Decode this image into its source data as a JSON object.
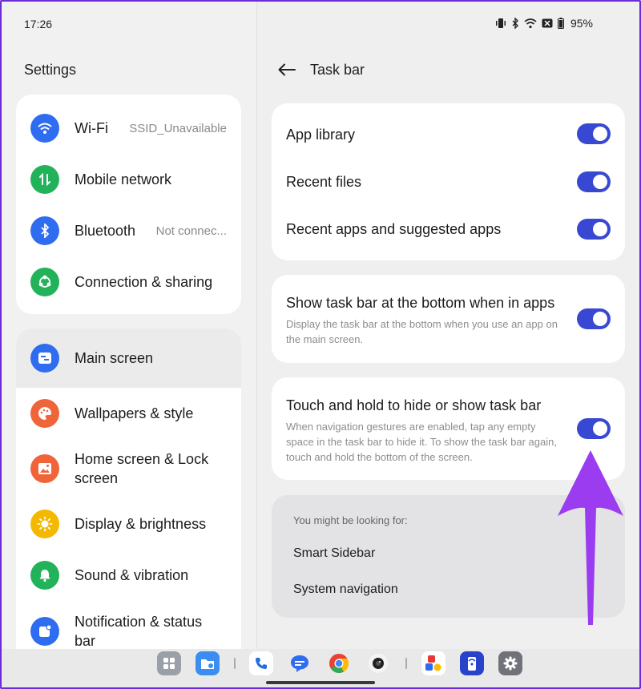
{
  "status_bar": {
    "time": "17:26",
    "battery": "95%"
  },
  "left_pane": {
    "title": "Settings",
    "group1": [
      {
        "label": "Wi-Fi",
        "value": "SSID_Unavailable",
        "icon": "wifi-icon"
      },
      {
        "label": "Mobile network",
        "value": "",
        "icon": "mobile-data-icon"
      },
      {
        "label": "Bluetooth",
        "value": "Not connec...",
        "icon": "bluetooth-icon"
      },
      {
        "label": "Connection & sharing",
        "value": "",
        "icon": "share-icon"
      }
    ],
    "group2": [
      {
        "label": "Main screen",
        "icon": "main-screen-icon"
      },
      {
        "label": "Wallpapers & style",
        "icon": "palette-icon"
      },
      {
        "label": "Home screen & Lock screen",
        "icon": "image-icon"
      },
      {
        "label": "Display & brightness",
        "icon": "sun-icon"
      },
      {
        "label": "Sound & vibration",
        "icon": "bell-icon"
      },
      {
        "label": "Notification & status bar",
        "icon": "notification-icon"
      }
    ]
  },
  "right_pane": {
    "title": "Task bar",
    "card1": [
      {
        "label": "App library",
        "on": true
      },
      {
        "label": "Recent files",
        "on": true
      },
      {
        "label": "Recent apps and suggested apps",
        "on": true
      }
    ],
    "card2": {
      "label": "Show task bar at the bottom when in apps",
      "description": "Display the task bar at the bottom when you use an app on the main screen.",
      "on": true
    },
    "card3": {
      "label": "Touch and hold to hide or show task bar",
      "description": "When navigation gestures are enabled, tap any empty space in the task bar to hide it. To show the task bar again, touch and hold the bottom of the screen.",
      "on": true
    },
    "suggestions": {
      "header": "You might be looking for:",
      "links": [
        "Smart Sidebar",
        "System navigation"
      ]
    }
  },
  "colors": {
    "accent": "#3848d3",
    "annotation_arrow": "#9b3cf0",
    "wifi": "#2f6df0",
    "mobile": "#22b35a",
    "bluetooth": "#2f6df0",
    "sharing": "#22b35a",
    "main_screen": "#2f6df0",
    "wallpaper": "#f0643a",
    "lock_screen": "#f0643a",
    "display": "#f5b800",
    "sound": "#22b35a",
    "notification": "#2f6df0"
  },
  "dock": [
    "app-drawer-icon",
    "files-icon",
    "phone-icon",
    "messages-icon",
    "chrome-icon",
    "camera-icon",
    "app-pair-icon",
    "remote-icon",
    "settings-icon"
  ]
}
